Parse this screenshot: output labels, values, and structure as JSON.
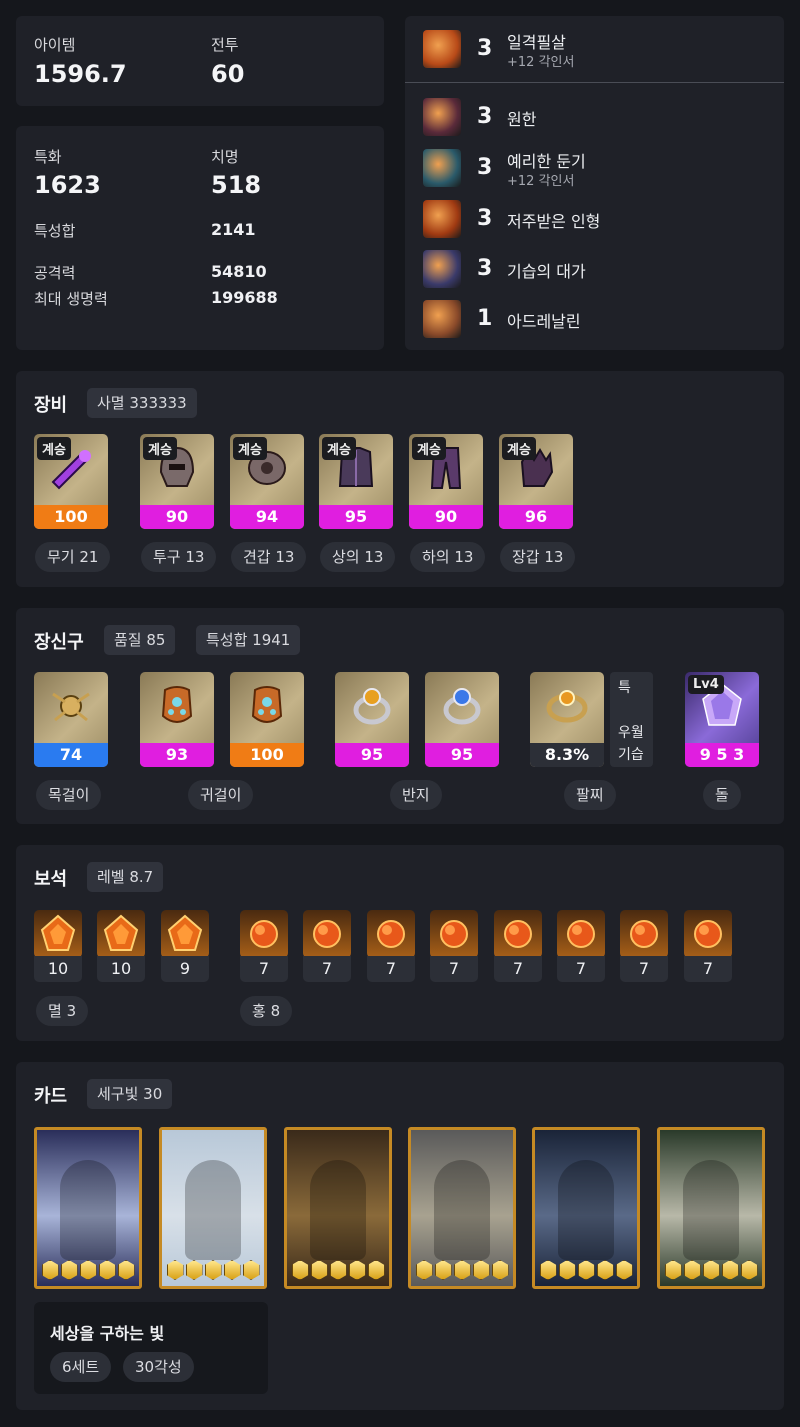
{
  "stats": {
    "item_label": "아이템",
    "item_value": "1596.7",
    "battle_label": "전투",
    "battle_value": "60",
    "spec_label": "특화",
    "spec_value": "1623",
    "crit_label": "치명",
    "crit_value": "518",
    "sum_label": "특성합",
    "sum_value": "2141",
    "atk_label": "공격력",
    "atk_value": "54810",
    "hp_label": "최대 생명력",
    "hp_value": "199688"
  },
  "engravings": [
    {
      "level": "3",
      "name": "일격필살",
      "sub": "+12 각인서",
      "icon": "strike-engraving-icon",
      "color": "#b84a18"
    },
    {
      "level": "3",
      "name": "원한",
      "sub": "",
      "icon": "grudge-engraving-icon",
      "color": "#5a2a3a"
    },
    {
      "level": "3",
      "name": "예리한 둔기",
      "sub": "+12 각인서",
      "icon": "keen-blunt-engraving-icon",
      "color": "#2a5a6a"
    },
    {
      "level": "3",
      "name": "저주받은 인형",
      "sub": "",
      "icon": "cursed-doll-engraving-icon",
      "color": "#a03a12"
    },
    {
      "level": "3",
      "name": "기습의 대가",
      "sub": "",
      "icon": "master-ambush-engraving-icon",
      "color": "#3a3a6a"
    },
    {
      "level": "1",
      "name": "아드레날린",
      "sub": "",
      "icon": "adrenaline-engraving-icon",
      "color": "#8a4a2a"
    }
  ],
  "equipment": {
    "title": "장비",
    "elixir": "사멸 333333",
    "items": [
      {
        "tag": "계승",
        "quality": "100",
        "bar": "orange",
        "label": "무기 21",
        "icon": "weapon-icon"
      },
      {
        "tag": "계승",
        "quality": "90",
        "bar": "mag",
        "label": "투구 13",
        "icon": "helmet-icon"
      },
      {
        "tag": "계승",
        "quality": "94",
        "bar": "mag",
        "label": "견갑 13",
        "icon": "shoulder-icon"
      },
      {
        "tag": "계승",
        "quality": "95",
        "bar": "mag",
        "label": "상의 13",
        "icon": "chest-icon"
      },
      {
        "tag": "계승",
        "quality": "90",
        "bar": "mag",
        "label": "하의 13",
        "icon": "pants-icon"
      },
      {
        "tag": "계승",
        "quality": "96",
        "bar": "mag",
        "label": "장갑 13",
        "icon": "gloves-icon"
      }
    ]
  },
  "accessories": {
    "title": "장신구",
    "quality": "품질 85",
    "stat_sum": "특성합 1941",
    "items": [
      {
        "value": "74",
        "bar": "blue",
        "icon": "necklace-icon"
      },
      {
        "value": "93",
        "bar": "mag",
        "icon": "earring-icon"
      },
      {
        "value": "100",
        "bar": "orange",
        "icon": "earring-icon"
      },
      {
        "value": "95",
        "bar": "mag",
        "icon": "ring-icon"
      },
      {
        "value": "95",
        "bar": "mag",
        "icon": "ring-icon"
      },
      {
        "value": "8.3%",
        "bar": "dark",
        "icon": "bracelet-icon"
      }
    ],
    "bracelet_tags": [
      "특",
      "우월",
      "기습"
    ],
    "stone_level": "Lv4",
    "stone_value": "9 5 3",
    "labels": [
      "목걸이",
      "귀걸이",
      "반지",
      "팔찌",
      "돌"
    ]
  },
  "gems": {
    "title": "보석",
    "level": "레벨 8.7",
    "values": [
      "10",
      "10",
      "9",
      "7",
      "7",
      "7",
      "7",
      "7",
      "7",
      "7",
      "7"
    ],
    "labels": [
      "멸 3",
      "홍 8"
    ]
  },
  "cards": {
    "title": "카드",
    "awaken": "세구빛 30",
    "set_name": "세상을 구하는 빛",
    "set_count": "6세트",
    "set_awaken": "30각성",
    "colors": [
      [
        "#2a2e5a",
        "#a8b4d8"
      ],
      [
        "#b8c8d8",
        "#d8e0e8"
      ],
      [
        "#3a2a1a",
        "#8a6a3a"
      ],
      [
        "#5a5a5a",
        "#a8a290"
      ],
      [
        "#1a2438",
        "#5a6a88"
      ],
      [
        "#2a3a2a",
        "#b8b8a8"
      ]
    ],
    "names": [
      "card-azena-inanna",
      "card-kadan",
      "card-thirain",
      "card-balthorr",
      "card-shandi",
      "card-ninave"
    ]
  }
}
